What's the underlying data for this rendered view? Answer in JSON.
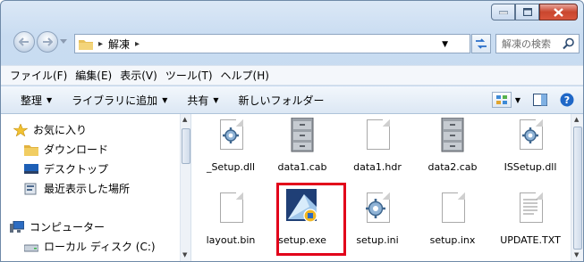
{
  "window": {
    "caption_buttons": [
      "minimize",
      "maximize",
      "close"
    ]
  },
  "address": {
    "crumb": "解凍",
    "search_placeholder": "解凍の検索"
  },
  "menu": {
    "items": [
      "ファイル(F)",
      "編集(E)",
      "表示(V)",
      "ツール(T)",
      "ヘルプ(H)"
    ]
  },
  "toolbar": {
    "organize": "整理",
    "add_to_library": "ライブラリに追加",
    "share": "共有",
    "new_folder": "新しいフォルダー"
  },
  "nav": {
    "favorites": "お気に入り",
    "downloads": "ダウンロード",
    "desktop": "デスクトップ",
    "recent": "最近表示した場所",
    "computer": "コンピューター",
    "local_disk": "ローカル ディスク (C:)"
  },
  "files": [
    {
      "name": "_Setup.dll",
      "icon": "gear-doc-icon"
    },
    {
      "name": "data1.cab",
      "icon": "cabinet-icon"
    },
    {
      "name": "data1.hdr",
      "icon": "blank-doc-icon"
    },
    {
      "name": "data2.cab",
      "icon": "cabinet-icon"
    },
    {
      "name": "ISSetup.dll",
      "icon": "gear-doc-icon"
    },
    {
      "name": "layout.bin",
      "icon": "blank-doc-icon"
    },
    {
      "name": "setup.exe",
      "icon": "installer-icon"
    },
    {
      "name": "setup.ini",
      "icon": "gear-doc-icon"
    },
    {
      "name": "setup.inx",
      "icon": "blank-doc-icon"
    },
    {
      "name": "UPDATE.TXT",
      "icon": "text-doc-icon"
    }
  ],
  "highlight_color": "#e2001a"
}
